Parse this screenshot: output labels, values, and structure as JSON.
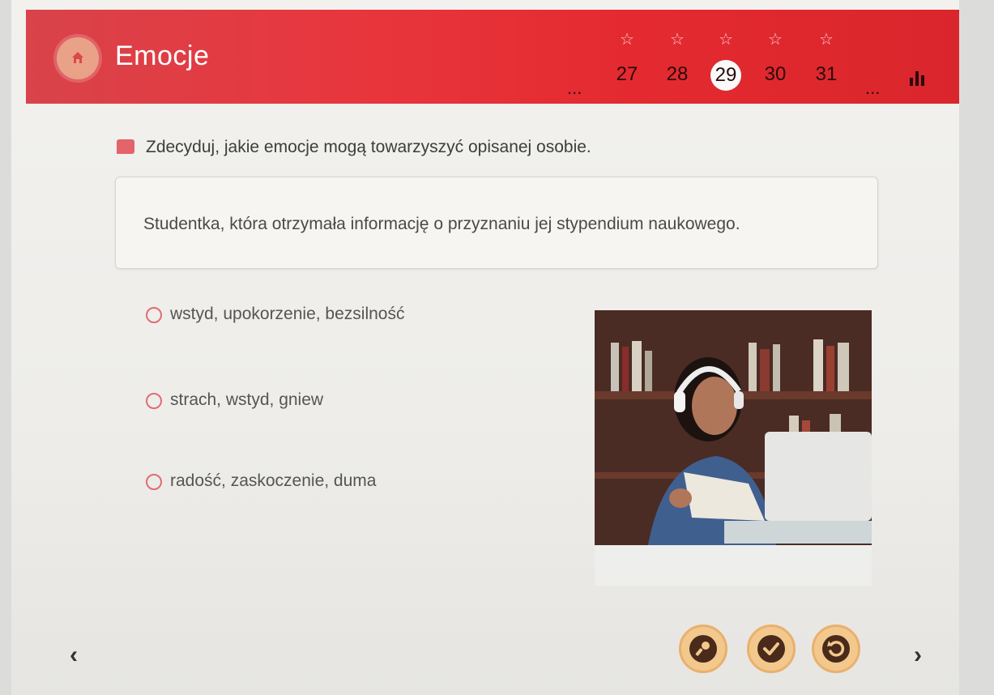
{
  "header": {
    "title": "Emocje",
    "home_icon": "home-icon",
    "stats_icon": "bar-chart-icon",
    "nav": {
      "ellipsis_left": "...",
      "ellipsis_right": "...",
      "items": [
        {
          "label": "27",
          "star": "☆"
        },
        {
          "label": "28",
          "star": "☆"
        },
        {
          "label": "29",
          "star": "☆",
          "current": true
        },
        {
          "label": "30",
          "star": "☆"
        },
        {
          "label": "31",
          "star": "☆"
        }
      ]
    }
  },
  "exercise": {
    "instruction": "Zdecyduj, jakie emocje mogą towarzyszyć opisanej osobie.",
    "prompt": "Studentka, która otrzymała informację o przyznaniu jej stypendium naukowego.",
    "options": [
      {
        "label": "wstyd, upokorzenie, bezsilność"
      },
      {
        "label": "strach, wstyd, gniew"
      },
      {
        "label": "radość, zaskoczenie, duma"
      }
    ]
  },
  "footer": {
    "prev_label": "‹",
    "next_label": "›",
    "buttons": [
      "key-icon",
      "check-icon",
      "undo-icon"
    ]
  },
  "colors": {
    "header": "#e4343a",
    "accent": "#e06d73",
    "button_fill": "#f2c88d"
  }
}
